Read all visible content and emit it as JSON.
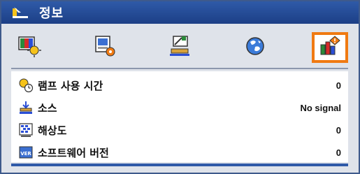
{
  "window": {
    "title": "정보"
  },
  "tabs": [
    {
      "icon": "image-settings-icon"
    },
    {
      "icon": "display-settings-icon"
    },
    {
      "icon": "setup-icon"
    },
    {
      "icon": "language-globe-icon"
    },
    {
      "icon": "information-icon",
      "selected": true
    }
  ],
  "info": {
    "rows": [
      {
        "label": "램프 사용 시간",
        "value": "0",
        "icon": "lamp-hours-icon"
      },
      {
        "label": "소스",
        "value": "No signal",
        "icon": "source-icon"
      },
      {
        "label": "해상도",
        "value": "0",
        "icon": "resolution-icon"
      },
      {
        "label": "소프트웨어 버전",
        "value": "0",
        "icon": "software-version-icon"
      }
    ]
  },
  "colors": {
    "accent": "#f07a12",
    "title_bar": "#2f5aa8"
  }
}
